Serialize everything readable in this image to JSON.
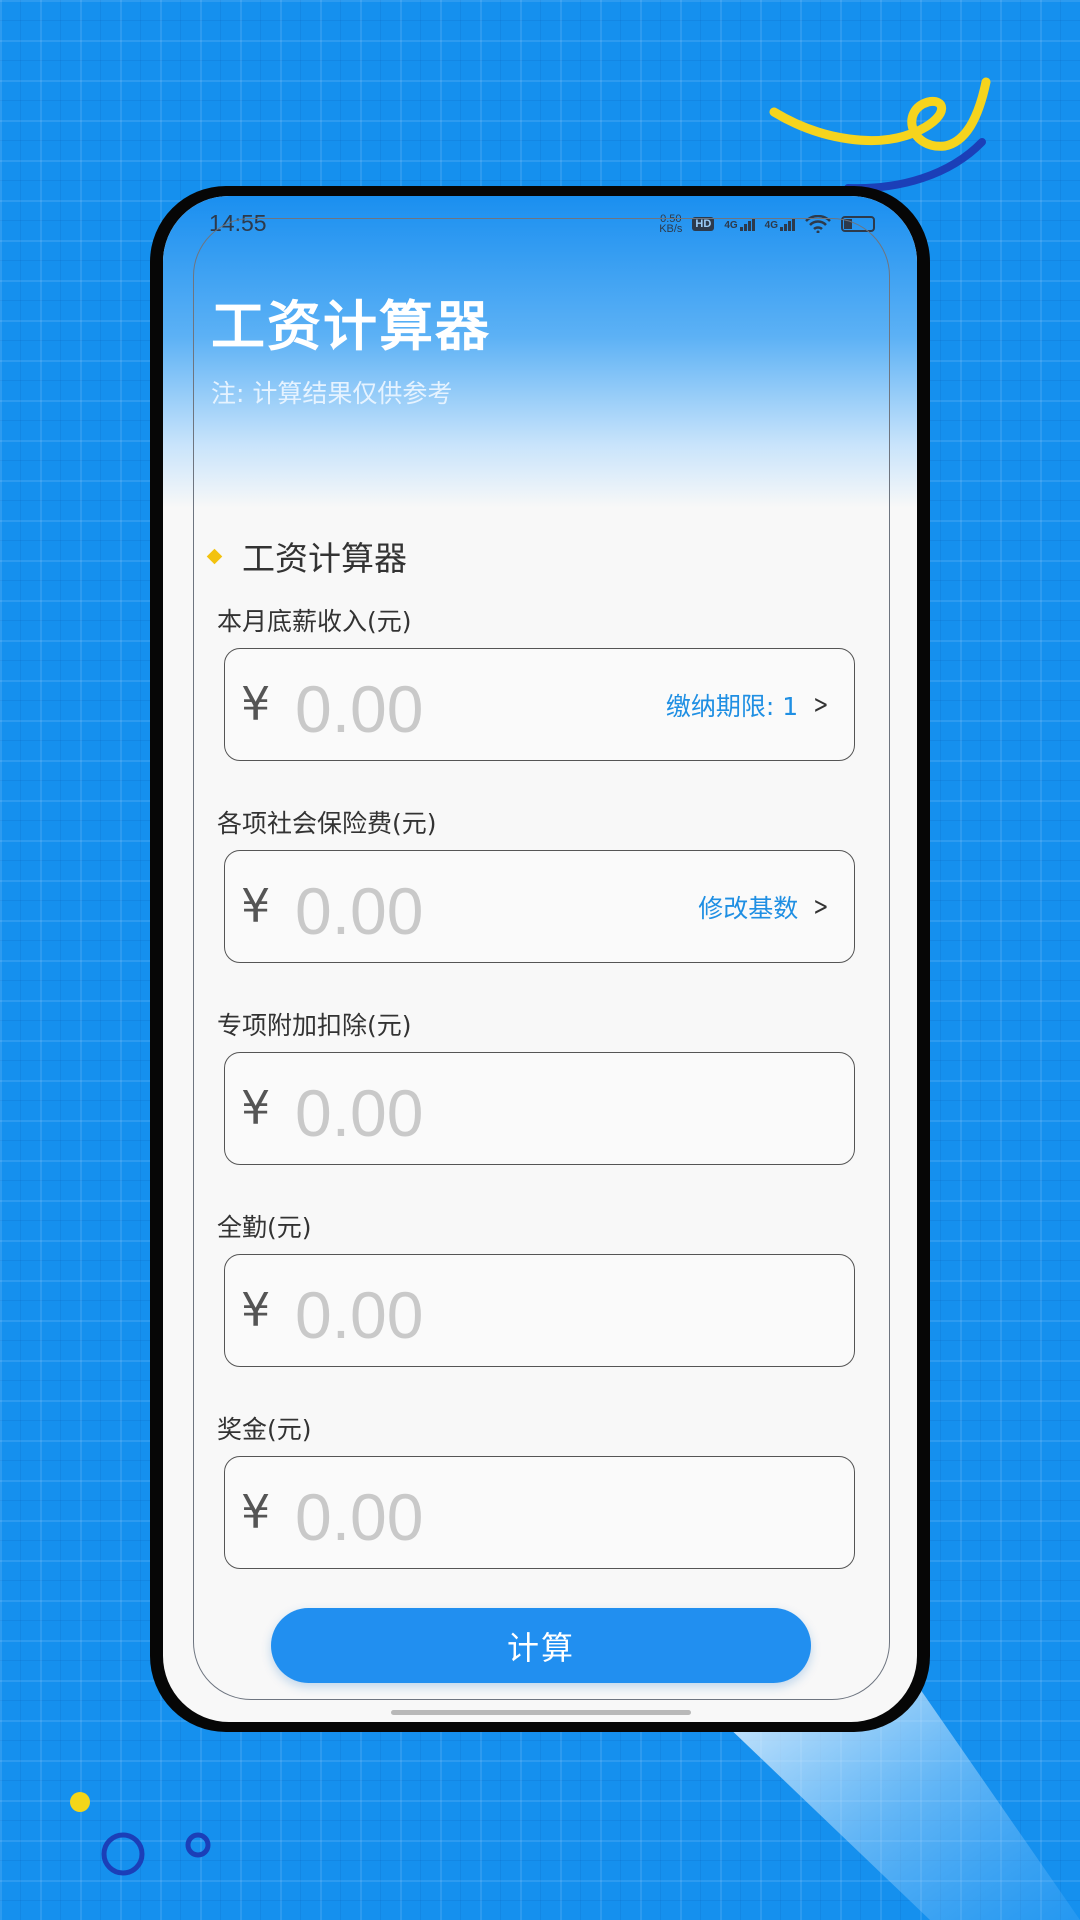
{
  "status_bar": {
    "time": "14:55",
    "net_speed_value": "0.50",
    "net_speed_unit": "KB/s",
    "hd_badge": "HD",
    "sim1_label": "4G",
    "sim2_label": "4G"
  },
  "header": {
    "title": "工资计算器",
    "note": "注: 计算结果仅供参考"
  },
  "section": {
    "title": "工资计算器"
  },
  "fields": [
    {
      "label": "本月底薪收入(元)",
      "currency": "¥",
      "placeholder": "0.00",
      "action": "缴纳期限: 1"
    },
    {
      "label": "各项社会保险费(元)",
      "currency": "¥",
      "placeholder": "0.00",
      "action": "修改基数"
    },
    {
      "label": "专项附加扣除(元)",
      "currency": "¥",
      "placeholder": "0.00"
    },
    {
      "label": "全勤(元)",
      "currency": "¥",
      "placeholder": "0.00"
    },
    {
      "label": "奖金(元)",
      "currency": "¥",
      "placeholder": "0.00"
    }
  ],
  "actions": {
    "calculate": "计算"
  },
  "colors": {
    "background": "#1590ee",
    "accent": "#218ff0",
    "link": "#1f8fe3",
    "diamond": "#f3c20f"
  }
}
